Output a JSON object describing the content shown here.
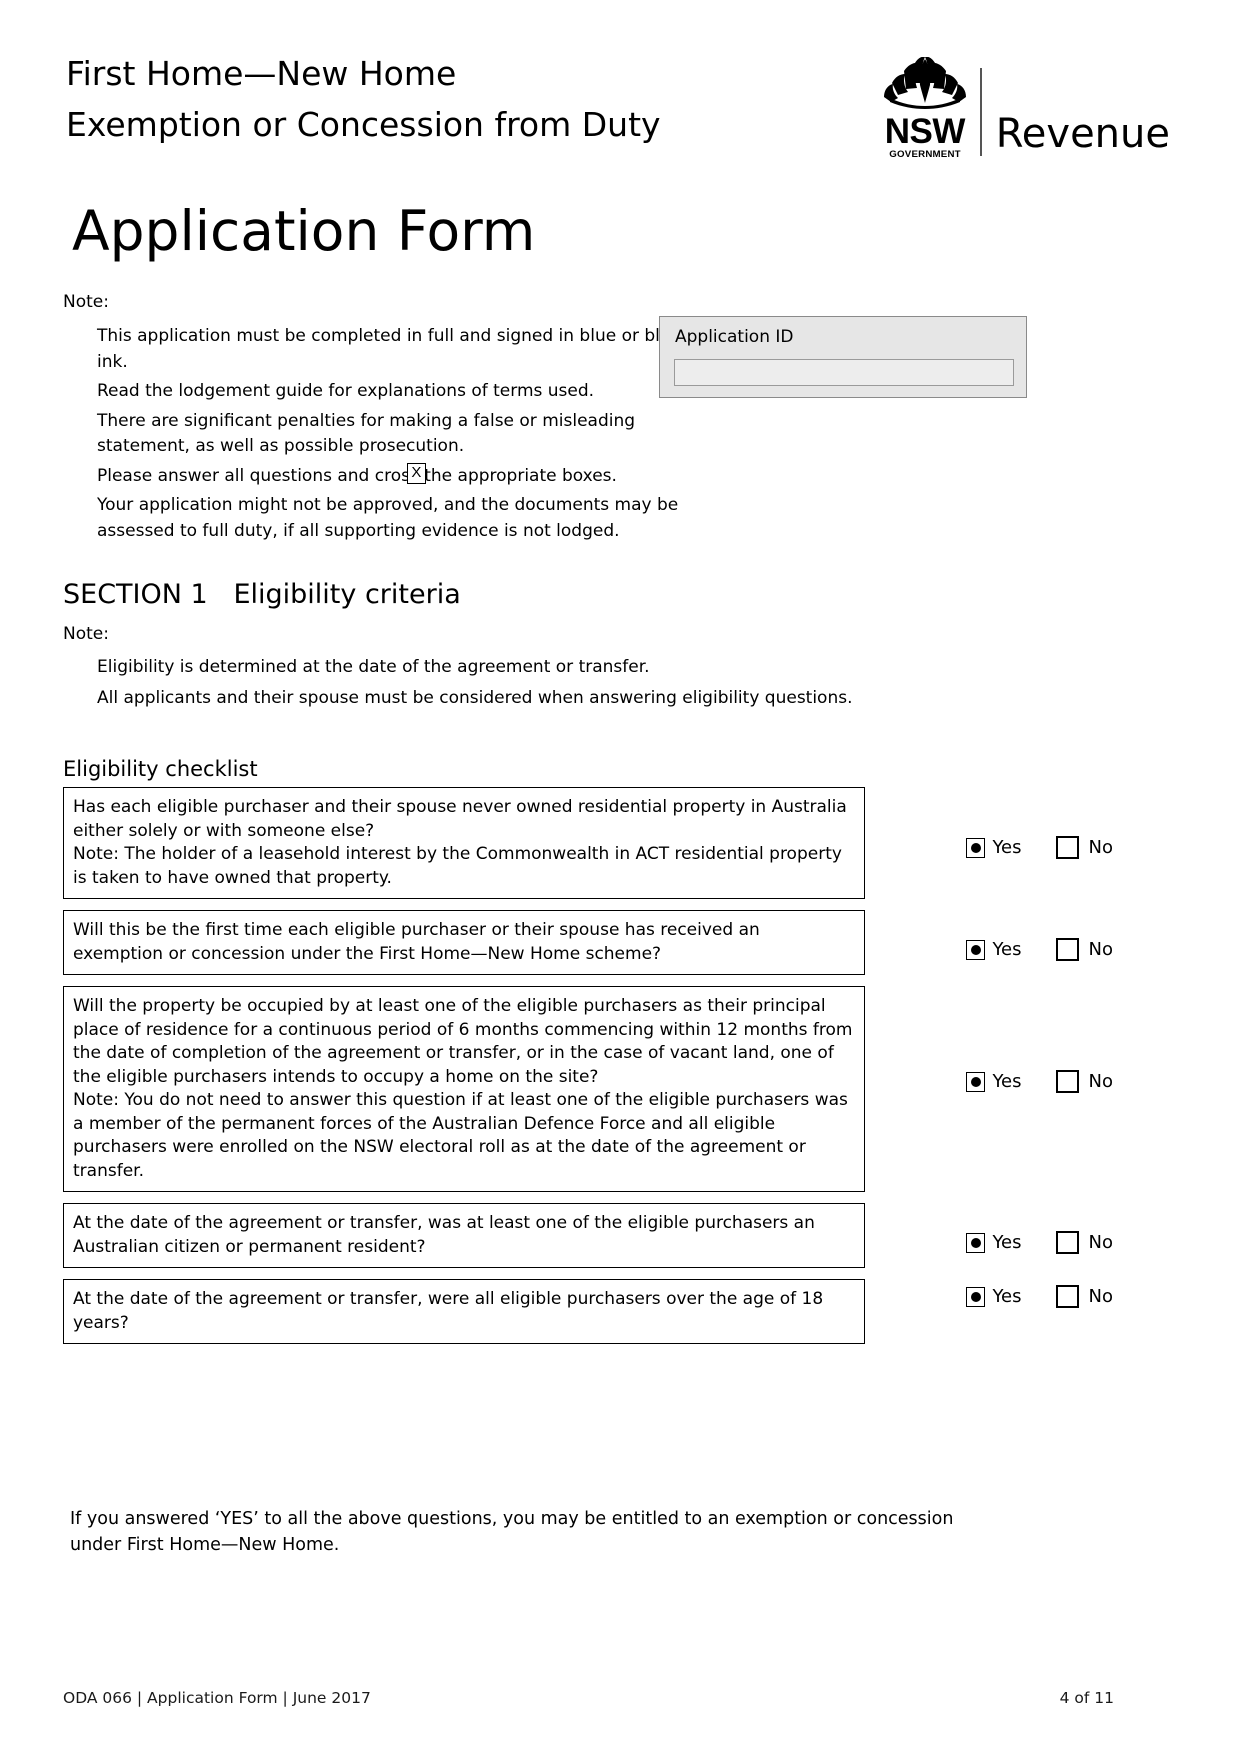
{
  "header": {
    "title_line1": "First Home—New Home",
    "title_line2": "Exemption or Concession from Duty",
    "logo": {
      "nsw_word": "NSW",
      "nsw_gov": "GOVERNMENT",
      "revenue": "Revenue",
      "flower_icon": "waratah-icon"
    }
  },
  "main": {
    "big_title": "Application Form",
    "note_label": "Note:",
    "notes": [
      "This application must be completed in full and signed in blue or black ink.",
      "Read the lodgement guide for explanations of terms used.",
      "There are significant penalties for making a false or misleading statement, as well as possible prosecution.",
      "Your application might not be approved, and the documents may be assessed to full duty, if all supporting evidence is not lodged."
    ],
    "cross_note": {
      "before": "Please answer all questions and cross",
      "after": "the appropriate boxes.",
      "box_mark": "X"
    },
    "application_id": {
      "label": "Application ID",
      "value": "",
      "placeholder": ""
    }
  },
  "section1": {
    "heading": "SECTION 1   Eligibility criteria",
    "note_label": "Note:",
    "notes": [
      "Eligibility is determined at the date of the agreement or transfer.",
      "All applicants and their spouse must be considered when answering eligibility questions."
    ],
    "checklist_heading": "Eligibility checklist",
    "answer_labels": {
      "yes": "Yes",
      "no": "No"
    },
    "questions": [
      {
        "text": "Has each eligible purchaser and their spouse never owned residential property in Australia either solely or with someone else?",
        "note": "Note: The holder of a leasehold interest by the Commonwealth in ACT residential property is taken to have owned that property.",
        "answer": "Yes"
      },
      {
        "text": "Will this be the first time each eligible purchaser or their spouse has received an exemption or concession under the First Home—New Home scheme?",
        "note": "",
        "answer": "Yes"
      },
      {
        "text": "Will the property be occupied by at least one of the eligible purchasers as their principal place of residence for a continuous period of 6 months commencing within 12 months from the date of completion of the agreement or transfer, or in the case of vacant land, one of the eligible purchasers intends to occupy a home on the site?",
        "note": "Note: You do not need to answer this question if at least one of the eligible purchasers was a member of the permanent forces of the Australian Defence Force and all eligible purchasers were enrolled on the NSW electoral roll as at the date of the agreement or transfer.",
        "answer": "Yes"
      },
      {
        "text": "At the date of the agreement or transfer, was at least one of the eligible purchasers an Australian citizen or permanent resident?",
        "note": "",
        "answer": "Yes"
      },
      {
        "text": "At the date of the agreement or transfer, were all eligible purchasers over the age of 18 years?",
        "note": "",
        "answer": "Yes"
      }
    ],
    "closing": "If you answered ‘YES’ to all the above questions, you may be entitled to an exemption or concession under First Home—New Home."
  },
  "footer": {
    "left": "ODA 066  |  Application Form  |  June 2017",
    "right": "4 of 11"
  }
}
